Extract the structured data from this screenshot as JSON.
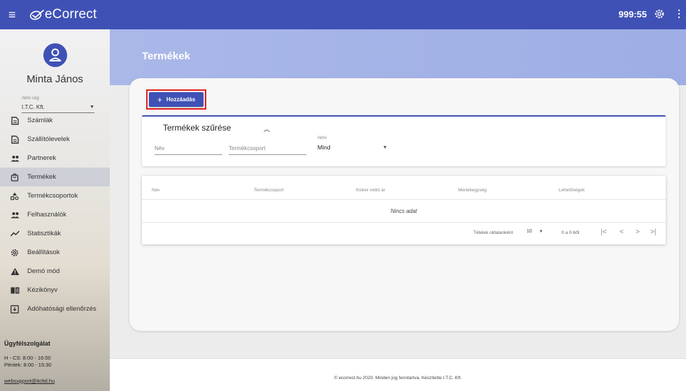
{
  "header": {
    "menu_icon": "hamburger-icon",
    "logo_icon": "ecorrect-logo-icon",
    "app_name": "eCorrect",
    "timer": "999:55",
    "settings_icon": "gear-icon",
    "more_icon": "more-vertical-icon"
  },
  "sidebar": {
    "user_name": "Minta János",
    "company_label": "Aktív cég",
    "company_value": "I.T.C. Kft.",
    "items": [
      {
        "label": "Számlák",
        "icon": "document-icon"
      },
      {
        "label": "Szállítólevelek",
        "icon": "document-icon"
      },
      {
        "label": "Partnerek",
        "icon": "people-icon"
      },
      {
        "label": "Termékek",
        "icon": "bag-icon",
        "active": true
      },
      {
        "label": "Termékcsoportok",
        "icon": "category-icon"
      },
      {
        "label": "Felhasználók",
        "icon": "people-icon"
      },
      {
        "label": "Statisztikák",
        "icon": "trend-icon"
      },
      {
        "label": "Beállítások",
        "icon": "gear-icon"
      },
      {
        "label": "Demó mód",
        "icon": "warning-icon"
      },
      {
        "label": "Kézikönyv",
        "icon": "book-icon"
      },
      {
        "label": "Adóhatósági ellenőrzés",
        "icon": "inbox-icon"
      }
    ],
    "support": {
      "title": "Ügyfélszolgálat",
      "hours_1": "H - CS: 8:00 - 16:00",
      "hours_2": "Péntek: 8:00 - 15:30",
      "email": "websupport@itcltd.hu"
    }
  },
  "main": {
    "title": "Termékek",
    "add_button": "Hozzáadás",
    "filter": {
      "title": "Termékek szűrése",
      "name_placeholder": "Név",
      "group_placeholder": "Termékcsoport",
      "active_label": "Aktív",
      "active_value": "Mind"
    },
    "table": {
      "columns": [
        "Név",
        "Termékcsoport",
        "Kisker nettó ár",
        "Mértékegység",
        "Lehetőségek"
      ],
      "empty_message": "Nincs adat",
      "rows_per_page_label": "Tételek oldalanként",
      "rows_per_page": "10",
      "range": "0 a 0-ből"
    }
  },
  "footer": {
    "text": "© ecorrect.hu 2020. Minden jog fenntartva. Készítette I.T.C. Kft."
  },
  "colors": {
    "primary": "#3f51b5",
    "highlight_border": "#e02020",
    "band": "#a5b4e6"
  }
}
